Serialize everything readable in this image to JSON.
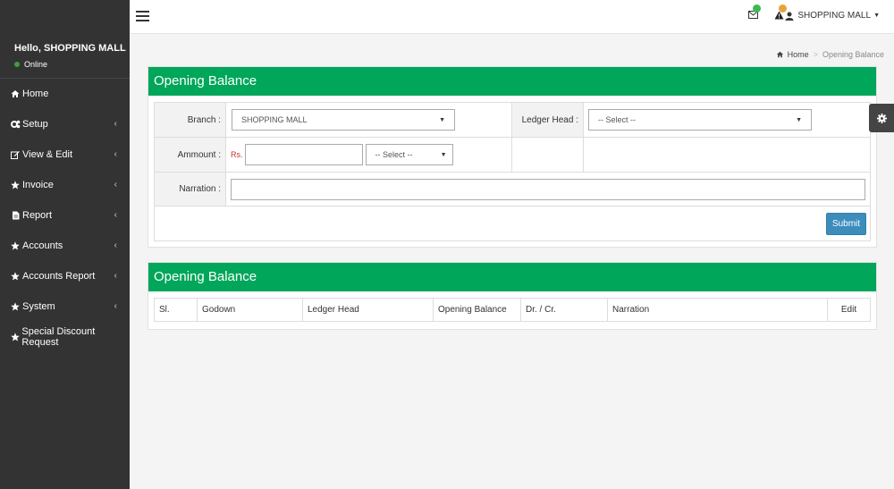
{
  "user": {
    "greeting": "Hello, SHOPPING MALL",
    "status": "Online"
  },
  "sidebar": {
    "items": [
      {
        "label": "Home",
        "icon": "home-icon",
        "has_submenu": false
      },
      {
        "label": "Setup",
        "icon": "cogs-icon",
        "has_submenu": true
      },
      {
        "label": "View & Edit",
        "icon": "edit-icon",
        "has_submenu": true
      },
      {
        "label": "Invoice",
        "icon": "star-icon",
        "has_submenu": true
      },
      {
        "label": "Report",
        "icon": "file-icon",
        "has_submenu": true
      },
      {
        "label": "Accounts",
        "icon": "star-icon",
        "has_submenu": true
      },
      {
        "label": "Accounts Report",
        "icon": "star-icon",
        "has_submenu": true
      },
      {
        "label": "System",
        "icon": "star-icon",
        "has_submenu": true
      },
      {
        "label": "Special Discount Request",
        "icon": "star-icon",
        "has_submenu": false
      }
    ]
  },
  "topbar": {
    "user_label": "SHOPPING MALL",
    "mail_badge_color": "#3cba4f",
    "alert_badge_color": "#e9a23b"
  },
  "breadcrumb": {
    "home": "Home",
    "current": "Opening Balance"
  },
  "form": {
    "title": "Opening Balance",
    "branch_label": "Branch :",
    "branch_value": "SHOPPING MALL",
    "ledger_label": "Ledger Head :",
    "ledger_value": "-- Select --",
    "amount_label": "Ammount :",
    "currency": "Rs.",
    "amount_value": "",
    "drcr_value": "-- Select --",
    "narration_label": "Narration :",
    "narration_value": "",
    "submit_label": "Submit"
  },
  "list": {
    "title": "Opening Balance",
    "columns": [
      "Sl.",
      "Godown",
      "Ledger Head",
      "Opening Balance",
      "Dr. / Cr.",
      "Narration",
      "Edit"
    ]
  },
  "colors": {
    "sidebar_bg": "#333333",
    "header_green": "#00a65a",
    "submit_blue": "#3c8dbc"
  }
}
